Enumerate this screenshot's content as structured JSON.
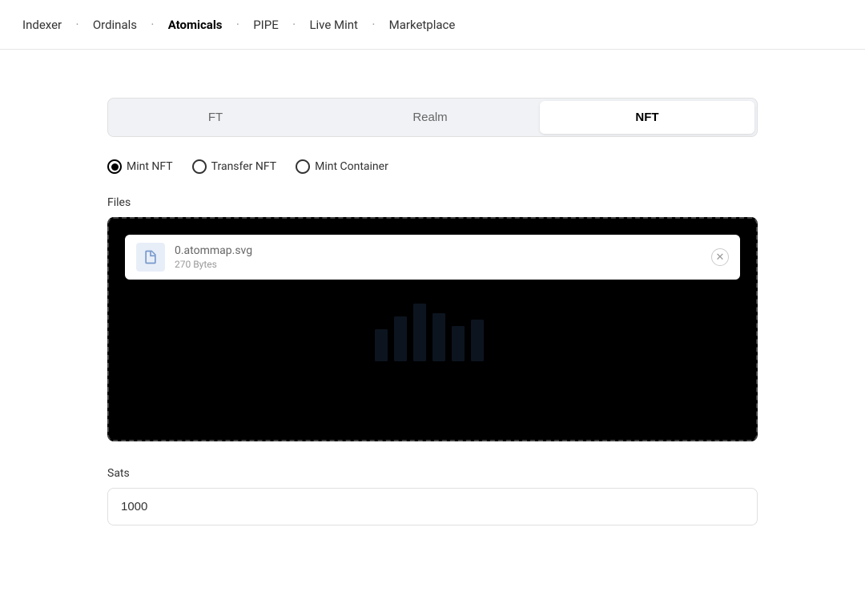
{
  "nav": {
    "items": [
      {
        "id": "indexer",
        "label": "Indexer",
        "active": false
      },
      {
        "id": "ordinals",
        "label": "Ordinals",
        "active": false
      },
      {
        "id": "atomicals",
        "label": "Atomicals",
        "active": true
      },
      {
        "id": "pipe",
        "label": "PIPE",
        "active": false
      },
      {
        "id": "live-mint",
        "label": "Live Mint",
        "active": false
      },
      {
        "id": "marketplace",
        "label": "Marketplace",
        "active": false
      }
    ]
  },
  "tabs": [
    {
      "id": "ft",
      "label": "FT",
      "active": false
    },
    {
      "id": "realm",
      "label": "Realm",
      "active": false
    },
    {
      "id": "nft",
      "label": "NFT",
      "active": true
    }
  ],
  "radio_group": {
    "options": [
      {
        "id": "mint-nft",
        "label": "Mint NFT",
        "selected": true
      },
      {
        "id": "transfer-nft",
        "label": "Transfer NFT",
        "selected": false
      },
      {
        "id": "mint-container",
        "label": "Mint Container",
        "selected": false
      }
    ]
  },
  "files": {
    "section_label": "Files",
    "file": {
      "name": "0.atommap.svg",
      "size": "270 Bytes"
    }
  },
  "sats": {
    "label": "Sats",
    "value": "1000",
    "placeholder": "1000"
  }
}
